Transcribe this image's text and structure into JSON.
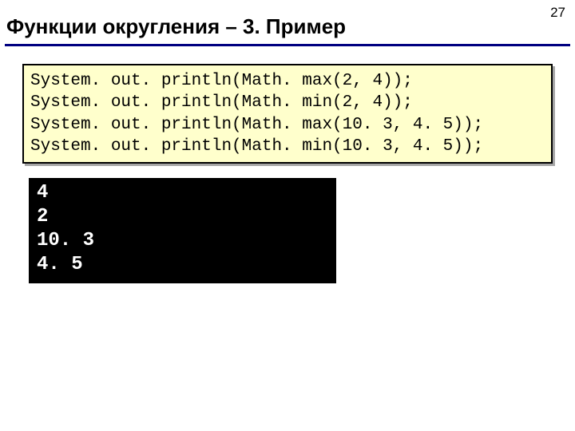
{
  "page_number": "27",
  "title": "Функции округления – 3. Пример",
  "code_lines": [
    "System. out. println(Math. max(2, 4));",
    "System. out. println(Math. min(2, 4));",
    "System. out. println(Math. max(10. 3, 4. 5));",
    "System. out. println(Math. min(10. 3, 4. 5));"
  ],
  "output_lines": [
    "4",
    "2",
    "10. 3",
    "4. 5"
  ]
}
